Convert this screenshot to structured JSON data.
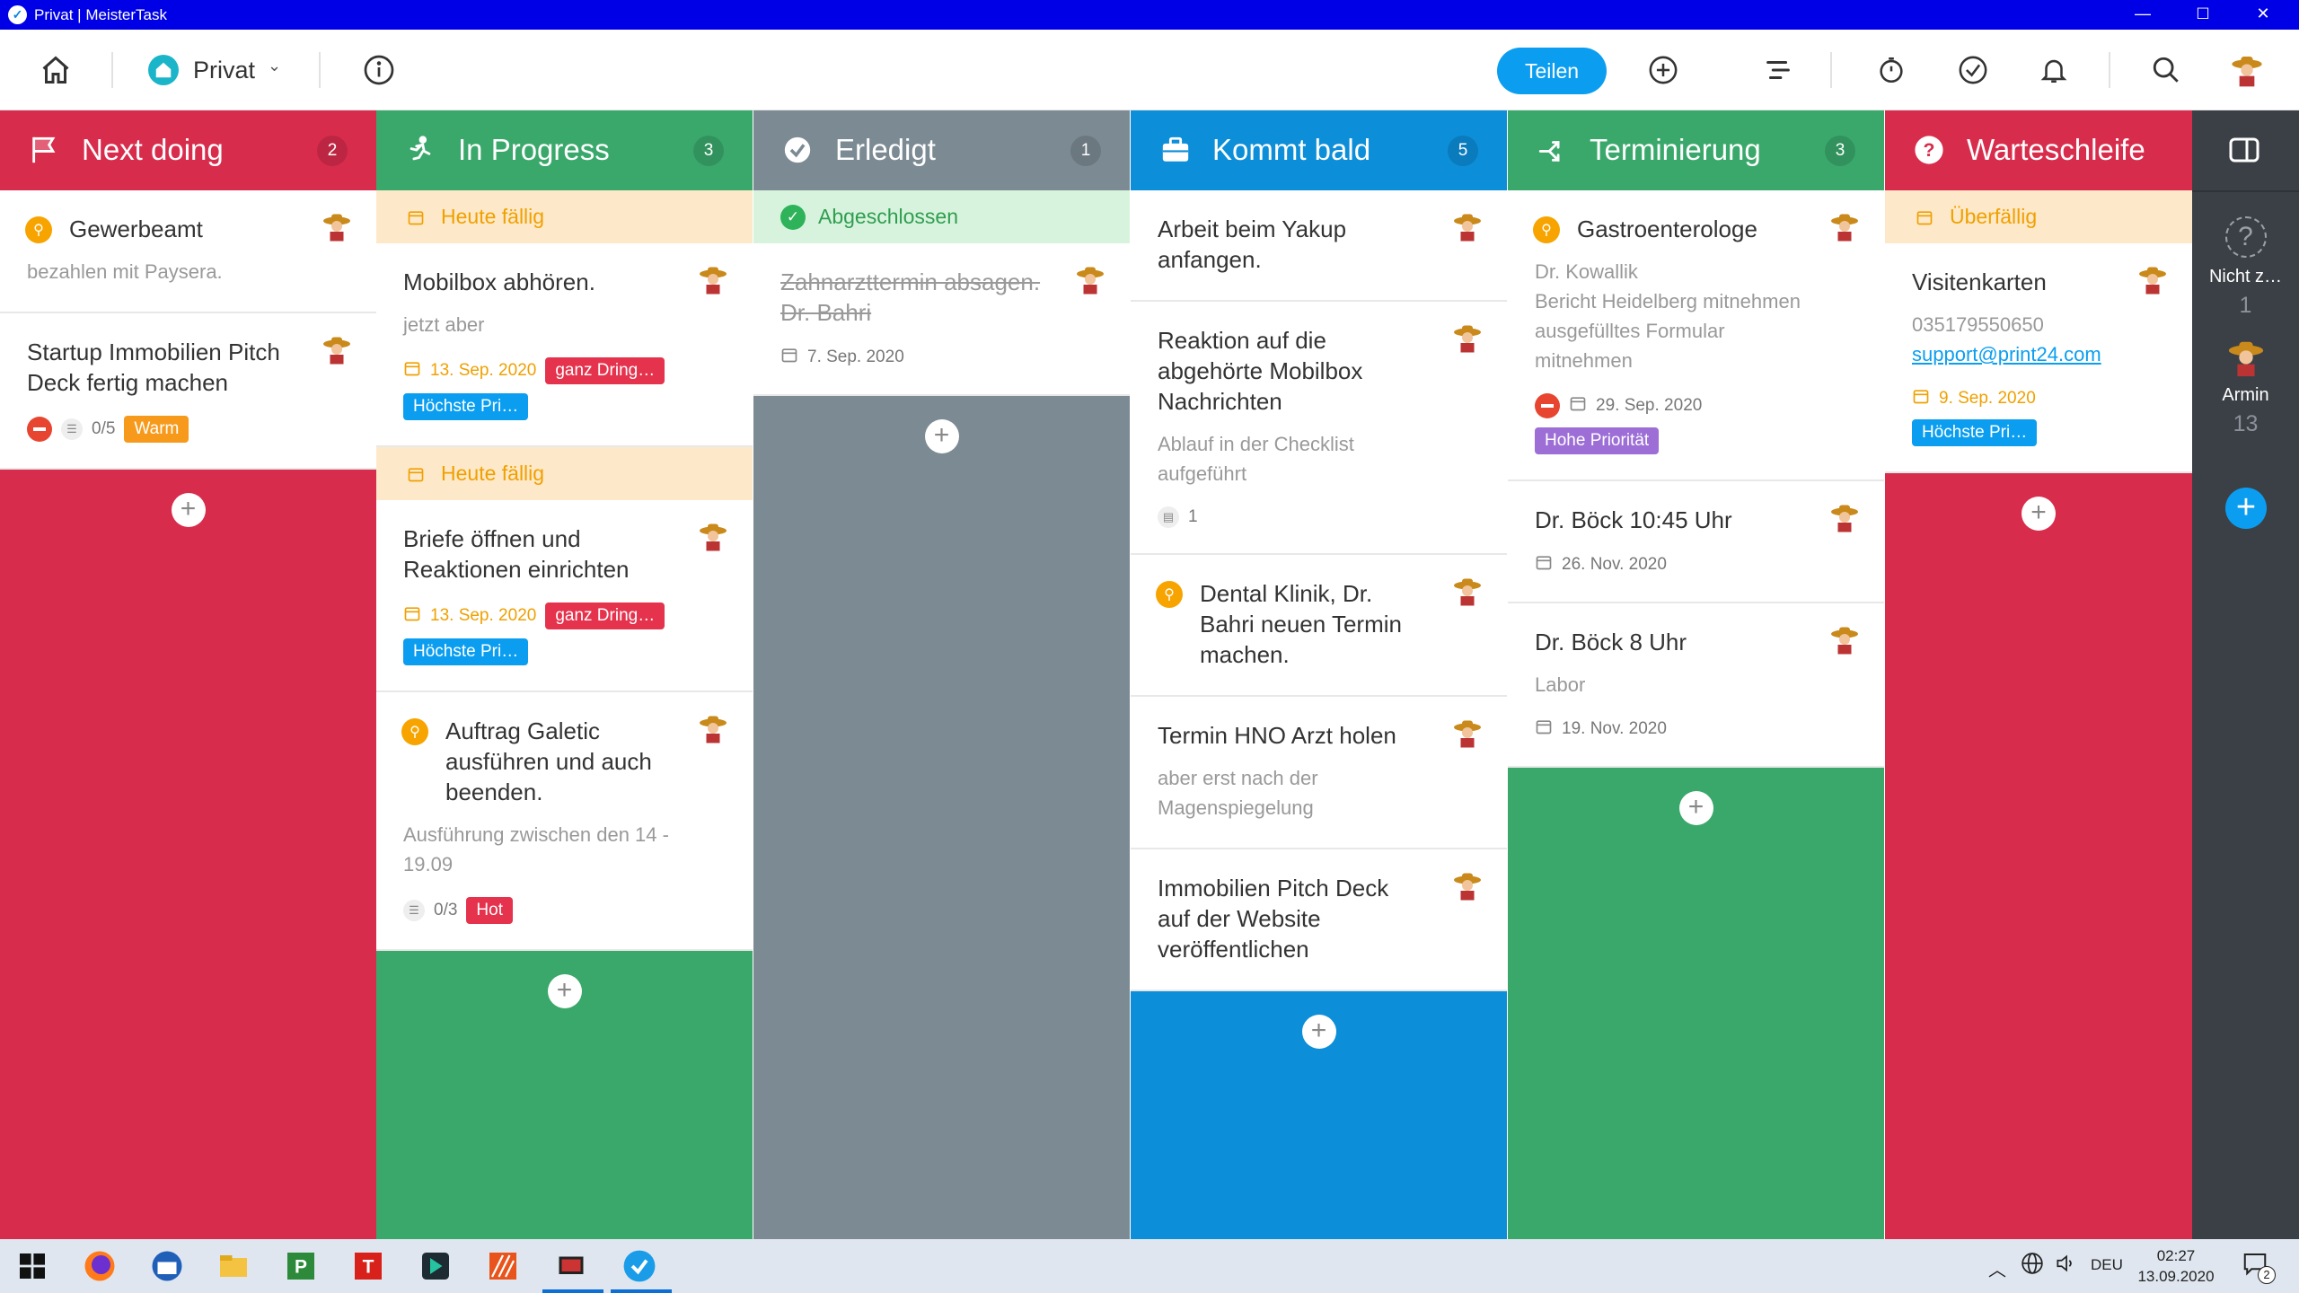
{
  "window": {
    "title": "Privat | MeisterTask",
    "min_label": "—",
    "max_label": "☐",
    "close_label": "✕"
  },
  "toolbar": {
    "project_name": "Privat",
    "share_label": "Teilen",
    "icons": [
      "home-icon",
      "project-icon",
      "chevron-down-icon",
      "info-icon",
      "plus-circle-icon",
      "timeline-icon",
      "stopwatch-icon",
      "checkmark-circle-icon",
      "bell-icon",
      "search-icon",
      "avatar"
    ]
  },
  "colors": {
    "next_doing": "#d82c4c",
    "in_progress": "#3aa86b",
    "erledigt": "#7c8a93",
    "kommt_bald": "#0c8ed8",
    "terminierung": "#3aa86b",
    "warteschleife": "#d82c4c",
    "due_band": "#fde9c9",
    "done_band": "#d8f3dd",
    "tag_red": "#e5324d",
    "tag_blue": "#0b9ef0",
    "tag_orange": "#f79a1b",
    "tag_purple": "#9c6ed6"
  },
  "columns": [
    {
      "name": "Next doing",
      "count": "2",
      "icon": "flag-icon",
      "tasks": [
        {
          "title": "Gewerbeamt",
          "pinned": true,
          "desc": "bezahlen mit Paysera."
        },
        {
          "title": "Startup Immobilien Pitch Deck fertig machen",
          "blocked": true,
          "checklist": "0/5",
          "tags": [
            {
              "label": "Warm",
              "color": "tag_orange"
            }
          ]
        }
      ]
    },
    {
      "name": "In Progress",
      "count": "3",
      "icon": "runner-icon",
      "sections": [
        {
          "label": "Heute fällig",
          "tasks": [
            {
              "title": "Mobilbox abhören.",
              "desc": "jetzt aber",
              "due": "13. Sep. 2020",
              "tags": [
                {
                  "label": "ganz Dring…",
                  "color": "tag_red"
                },
                {
                  "label": "Höchste Pri…",
                  "color": "tag_blue"
                }
              ]
            }
          ]
        },
        {
          "label": "Heute fällig",
          "tasks": [
            {
              "title": "Briefe öffnen und Reaktionen einrichten",
              "due": "13. Sep. 2020",
              "tags": [
                {
                  "label": "ganz Dring…",
                  "color": "tag_red"
                },
                {
                  "label": "Höchste Pri…",
                  "color": "tag_blue"
                }
              ]
            }
          ]
        },
        {
          "label": "",
          "tasks": [
            {
              "title": "Auftrag Galetic ausführen und auch beenden.",
              "pinned": true,
              "desc": "Ausführung zwischen den 14 - 19.09",
              "checklist": "0/3",
              "tags": [
                {
                  "label": "Hot",
                  "color": "tag_red"
                }
              ]
            }
          ]
        }
      ]
    },
    {
      "name": "Erledigt",
      "count": "1",
      "icon": "check-circle-icon",
      "section_label": "Abgeschlossen",
      "tasks": [
        {
          "title": "Zahnarzttermin absagen. Dr. Bahri",
          "done": true,
          "date": "7. Sep. 2020"
        }
      ]
    },
    {
      "name": "Kommt bald",
      "count": "5",
      "icon": "briefcase-icon",
      "tasks": [
        {
          "title": "Arbeit beim Yakup anfangen."
        },
        {
          "title": "Reaktion auf die abgehörte Mobilbox Nachrichten",
          "desc": "Ablauf in der Checklist aufgeführt",
          "comments": "1"
        },
        {
          "title": "Dental Klinik, Dr. Bahri neuen Termin machen.",
          "pinned": true
        },
        {
          "title": "Termin HNO Arzt holen",
          "desc": "aber erst nach der Magenspiegelung"
        },
        {
          "title": "Immobilien Pitch Deck auf der Website veröffentlichen"
        }
      ]
    },
    {
      "name": "Terminierung",
      "count": "3",
      "icon": "split-arrow-icon",
      "tasks": [
        {
          "title": "Gastroenterologe",
          "pinned": true,
          "desc": "Dr. Kowallik\nBericht Heidelberg mitnehmen\nausgefülltes Formular mitnehmen",
          "blocked": true,
          "date": "29. Sep. 2020",
          "tags": [
            {
              "label": "Hohe Priorität",
              "color": "tag_purple"
            }
          ]
        },
        {
          "title": "Dr. Böck 10:45 Uhr",
          "date": "26. Nov. 2020"
        },
        {
          "title": "Dr. Böck 8 Uhr",
          "desc": "Labor",
          "date": "19. Nov. 2020"
        }
      ]
    },
    {
      "name": "Warteschleife",
      "count": "",
      "icon": "question-icon",
      "section_label": "Überfällig",
      "tasks": [
        {
          "title": "Visitenkarten",
          "desc": "035179550650",
          "link": "support@print24.com",
          "due": "9. Sep. 2020",
          "tags": [
            {
              "label": "Höchste Pri…",
              "color": "tag_blue"
            }
          ]
        }
      ]
    }
  ],
  "rail": {
    "items": [
      {
        "name": "Nicht z…",
        "count": "1"
      },
      {
        "name": "Armin",
        "count": "13"
      }
    ]
  },
  "taskbar": {
    "time": "02:27",
    "date": "13.09.2020",
    "lang": "DEU",
    "notif_count": "2"
  }
}
